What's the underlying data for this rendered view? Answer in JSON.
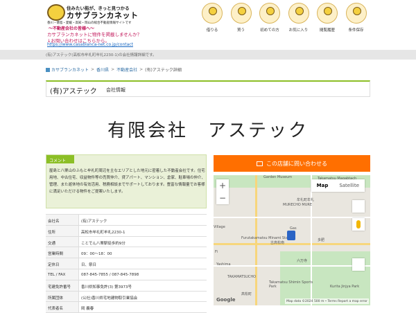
{
  "header": {
    "tagline": "住みたい街が、きっと見つかる",
    "logo_title": "カサブランカネット",
    "logo_sub": "香川・徳島・愛媛・高知・岡山の総合不動産情報サイトです",
    "promo1": "〜不動産会社の皆様へ〜",
    "promo2": "カサブランカネットに物件を掲載しませんか？",
    "promo3": "↓お問い合わせはこちらから。",
    "promo_link": "https://www.casablanca-net.co.jp/contact",
    "nav": [
      "借りる",
      "買う",
      "初めての方",
      "お気に入り",
      "閲覧履歴",
      "条件保存"
    ]
  },
  "addressbar": "(有)アステック(高松市牟礼町牟礼2230-1)の会社情報詳細です。",
  "breadcrumb": {
    "items": [
      "カサブランカネット",
      "香川県",
      "不動産会社",
      "(有)アステック詳細"
    ]
  },
  "title": {
    "name": "(有)アステック",
    "sub": "会社情報"
  },
  "big_name": "有限会社　アステック",
  "comment": {
    "tag": "コメント",
    "text": "屋島と八栗山のふもと牟礼町周辺を主なエリアとした地元に密着した不動産会社です。住宅用地、中古住宅、収益物件等の売買仲介、貸アパート、マンション、倉家、駐車場の仲介、管理、また遊休地の有効活用、税務相談までサポートしております。豊富な情報量でお客様に満足いただける物件をご提案いたします。"
  },
  "info": [
    {
      "k": "会社名",
      "v": "(有)アステック"
    },
    {
      "k": "住所",
      "v": "高松市牟礼町牟礼2230-1"
    },
    {
      "k": "交通",
      "v": "ことでん八栗駅徒歩約9分"
    },
    {
      "k": "営業時間",
      "v": "09：00～18：00"
    },
    {
      "k": "定休日",
      "v": "日、祭日"
    },
    {
      "k": "TEL / FAX",
      "v": "087-845-7855 / 087-845-7898"
    },
    {
      "k": "宅建免許番号",
      "v": "香川県知事免許(3) 第3973号"
    },
    {
      "k": "所属団体",
      "v": "(公社)香川県宅地建物取引業協会"
    },
    {
      "k": "代表者名",
      "v": "岡 義春"
    }
  ],
  "contact_button": "この店舗に問い合わせる",
  "map": {
    "toggle_map": "Map",
    "toggle_satellite": "Satellite",
    "labels": [
      "Garden Museum",
      "Takamatsu Magabtach",
      "牟礼町牟礼",
      "MURECHO MURE",
      "Furutakamatsu Minami Station",
      "古高松南",
      "Village",
      "Fi",
      "Yashima",
      "TAKAMATSUCHO",
      "Takamatsu Shimin Sports Park",
      "高松町",
      "Gas",
      "Kurita Jinjya Park",
      "六万寺",
      "多肥"
    ],
    "footer": "Map data ©2024   500 m ⎯   Terms   Report a map error",
    "google": "Google"
  },
  "colors": {
    "accent_green": "#8cbf26",
    "orange": "#ff6f00",
    "pink": "#c2185b"
  }
}
